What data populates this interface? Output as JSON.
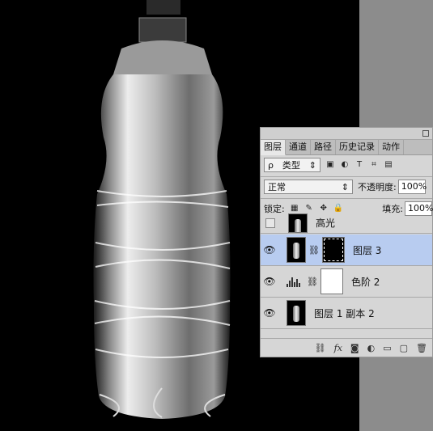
{
  "panel": {
    "tabs": [
      {
        "label": "图层",
        "active": true
      },
      {
        "label": "通道",
        "active": false
      },
      {
        "label": "路径",
        "active": false
      },
      {
        "label": "历史记录",
        "active": false
      },
      {
        "label": "动作",
        "active": false
      }
    ],
    "filter": {
      "search_icon": "ρ",
      "kind_label": "类型",
      "kind_arrow": "⇕"
    },
    "blend_mode": "正常",
    "blend_arrow": "⇕",
    "opacity_label": "不透明度:",
    "opacity_value": "100%",
    "lock_label": "锁定:",
    "fill_label": "填充:",
    "fill_value": "100%",
    "layers": [
      {
        "name": "高光",
        "visible": false,
        "selected": false
      },
      {
        "name": "图层 3",
        "visible": true,
        "selected": true
      },
      {
        "name": "色阶 2",
        "visible": true,
        "selected": false
      },
      {
        "name": "图层 1 副本 2",
        "visible": true,
        "selected": false
      }
    ],
    "footer": {
      "fx": "fx"
    }
  },
  "colors": {
    "selected_row": "#b8ccf0",
    "panel_bg": "#d6d6d6",
    "workspace": "#8c8c8c"
  }
}
